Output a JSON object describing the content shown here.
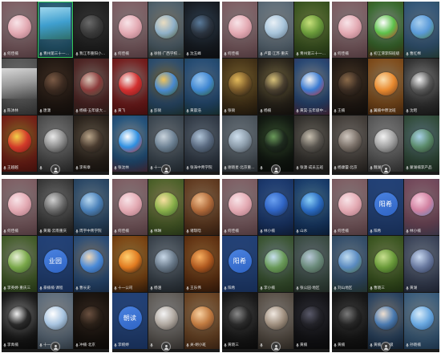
{
  "theme": {
    "speaking_border": "#34c759",
    "label_text": "#e6e6e6",
    "tile_gap": "#141414"
  },
  "icons": {
    "mic": "mic-icon",
    "self_view": "person-icon"
  },
  "screens": [
    {
      "tiles": [
        {
          "name": "何佳楠",
          "colors": [
            "#f8e4e8",
            "#e3aab3",
            "#a4707b"
          ]
        },
        {
          "name": "青州第三十一中学",
          "speaking": true,
          "video": true,
          "colors": [
            "#9fd8ee",
            "#3f9fcf",
            "#2f6f6a"
          ]
        },
        {
          "name": "我江市重阳小学7101班级",
          "colors": [
            "#6a6a6a",
            "#3a3a3a",
            "#1e1e1e"
          ]
        },
        {
          "name": "陈沐林",
          "video": true,
          "colors": [
            "#d8d8d8",
            "#9a9a9a",
            "#4a4a4a"
          ]
        },
        {
          "name": "唐潇",
          "colors": [
            "#7a5a45",
            "#3b2a20",
            "#1a1410"
          ]
        },
        {
          "name": "杨楠-五年级大班级",
          "colors": [
            "#d9c6b8",
            "#8a3b3b",
            "#3f4a3a"
          ]
        },
        {
          "name": "王越越",
          "colors": [
            "#f2d14a",
            "#d23a2a",
            "#7a1a14"
          ]
        },
        {
          "name": "",
          "colors": [
            "#e9e9e9",
            "#8c8c8c",
            "#2a2a2a"
          ]
        },
        {
          "name": "李宥章",
          "colors": [
            "#b9a58a",
            "#4a3c30",
            "#1c1815"
          ]
        }
      ]
    },
    {
      "tiles": [
        {
          "name": "何佳楠",
          "colors": [
            "#f8e4e8",
            "#e3aab3",
            "#a4707b"
          ]
        },
        {
          "name": "徐锐·广西学校班级",
          "colors": [
            "#e9dcc0",
            "#8fb0c8",
            "#4c5a3c"
          ]
        },
        {
          "name": "沈玉峰",
          "colors": [
            "#5a7a9a",
            "#2b3440",
            "#121418"
          ]
        },
        {
          "name": "黄飞",
          "colors": [
            "#f4f0ec",
            "#d23030",
            "#7a1a1a"
          ]
        },
        {
          "name": "彭硕",
          "colors": [
            "#f0c35a",
            "#4a8ad0",
            "#3a5a2a"
          ]
        },
        {
          "name": "黄晨浩",
          "colors": [
            "#9cc8f0",
            "#3f86d1",
            "#2f5a2a"
          ]
        },
        {
          "name": "张沈林",
          "colors": [
            "#ffffff",
            "#2e8fe0",
            "#d0302a"
          ]
        },
        {
          "name": "十一·公司",
          "colors": [
            "#c9d3dc",
            "#6e8294",
            "#2e3a44"
          ]
        },
        {
          "name": "张海中青学院",
          "colors": [
            "#b0c4d8",
            "#5a6a80",
            "#26303a"
          ]
        }
      ]
    },
    {
      "tiles": [
        {
          "name": "何佳楠",
          "colors": [
            "#f8e4e8",
            "#e3aab3",
            "#a4707b"
          ]
        },
        {
          "name": "卢蕾·江苏·重庆",
          "colors": [
            "#e8f0f6",
            "#a8c4da",
            "#5a6f80"
          ]
        },
        {
          "name": "青州第三十一中学",
          "colors": [
            "#c7e07a",
            "#6a9a3a",
            "#2f4a22"
          ]
        },
        {
          "name": "张硕",
          "colors": [
            "#e2b95a",
            "#7a5a2a",
            "#1e1812"
          ]
        },
        {
          "name": "杨楠",
          "colors": [
            "#d8c27a",
            "#4a4030",
            "#141210"
          ]
        },
        {
          "name": "黄昊-五年级中学班",
          "colors": [
            "#f4f4f4",
            "#3a7ad0",
            "#c03030"
          ]
        },
        {
          "name": "谢晓星·北京重庆班",
          "colors": [
            "#cfe0ee",
            "#8a9aa8",
            "#3a4048"
          ]
        },
        {
          "name": "",
          "colors": [
            "#6a9a5a",
            "#1e2a1e",
            "#0c0f0c"
          ]
        },
        {
          "name": "张潇·成员五班",
          "colors": [
            "#c8c0b0",
            "#5a5650",
            "#232220"
          ]
        }
      ]
    },
    {
      "tiles": [
        {
          "name": "何佳楠",
          "colors": [
            "#f8e4e8",
            "#e3aab3",
            "#a4707b"
          ]
        },
        {
          "name": "初江渭李阳班级",
          "colors": [
            "#ffffff",
            "#5cc04a",
            "#c0302a"
          ]
        },
        {
          "name": "曹红棉",
          "colors": [
            "#a9d0f0",
            "#5a9ad8",
            "#4a7a3a"
          ]
        },
        {
          "name": "王楠",
          "colors": [
            "#8a6a4a",
            "#3a2c22",
            "#15110d"
          ]
        },
        {
          "name": "翼楠中原沈班",
          "colors": [
            "#fbe0b0",
            "#e88a30",
            "#6a3a1a"
          ]
        },
        {
          "name": "沈昭",
          "colors": [
            "#f0f0f0",
            "#5a5a5a",
            "#1a1a1a"
          ]
        },
        {
          "name": "杨康蕾·北京",
          "colors": [
            "#d0c8c0",
            "#7a7068",
            "#2a2622"
          ]
        },
        {
          "name": "魏湖泽",
          "colors": [
            "#f2f2f2",
            "#a0a0a0",
            "#404040"
          ]
        },
        {
          "name": "蒙湖楠李产品",
          "colors": [
            "#a8d0e8",
            "#5a8a6a",
            "#2a3a2a"
          ]
        }
      ]
    },
    {
      "tiles": [
        {
          "name": "何佳楠",
          "colors": [
            "#f8e4e8",
            "#e3aab3",
            "#a4707b"
          ]
        },
        {
          "name": "黄瀚·云南重庆",
          "colors": [
            "#d0d0d0",
            "#6a6a6a",
            "#1a1a1a"
          ]
        },
        {
          "name": "周宇中青学院",
          "colors": [
            "#b8d8f0",
            "#4a80b8",
            "#2a3a4a"
          ]
        },
        {
          "name": "李英婷·重庆三",
          "colors": [
            "#e8f0d8",
            "#7aa84a",
            "#3a5a2a"
          ]
        },
        {
          "name": "豪楠楠·课程",
          "avatar_text": "业园",
          "colors": [
            "#4a82e0",
            "#2f64c4"
          ]
        },
        {
          "name": "曹长史",
          "colors": [
            "#f0d8b8",
            "#4a8ad8",
            "#2a4a7a"
          ]
        },
        {
          "name": "李禹楠",
          "colors": [
            "#f0f0f0",
            "#2a2a2a",
            "#080808"
          ]
        },
        {
          "name": "十一·中心",
          "colors": [
            "#ffffff",
            "#a8c4e0",
            "#4a5a6a"
          ]
        },
        {
          "name": "冲楠·北京",
          "colors": [
            "#6a5040",
            "#2a2018",
            "#100c0a"
          ]
        }
      ]
    },
    {
      "tiles": [
        {
          "name": "何佳楠",
          "colors": [
            "#f8e4e8",
            "#e3aab3",
            "#a4707b"
          ]
        },
        {
          "name": "林琳",
          "colors": [
            "#f8e0a0",
            "#8ab04a",
            "#3a5a2a"
          ]
        },
        {
          "name": "诸琰晗",
          "colors": [
            "#f0c090",
            "#b06a3a",
            "#4a2a1a"
          ]
        },
        {
          "name": "十一公司",
          "colors": [
            "#ffd070",
            "#e07a20",
            "#201410"
          ]
        },
        {
          "name": "杨涵",
          "colors": [
            "#c8d8e8",
            "#6a7a8a",
            "#2a323a"
          ]
        },
        {
          "name": "王乐伟",
          "colors": [
            "#f8b060",
            "#b05a20",
            "#3a1c0c"
          ]
        },
        {
          "name": "李婉婷",
          "avatar_text": "朝读",
          "colors": [
            "#4a82e0",
            "#2f64c4"
          ]
        },
        {
          "name": "",
          "colors": [
            "#f4f4f4",
            "#b0a8a0",
            "#4a4440"
          ]
        },
        {
          "name": "关-胡小班",
          "colors": [
            "#f8d0a0",
            "#c07a40",
            "#5a3420"
          ]
        }
      ]
    },
    {
      "tiles": [
        {
          "name": "何佳楠",
          "colors": [
            "#f8e4e8",
            "#e3aab3",
            "#a4707b"
          ]
        },
        {
          "name": "林小楠",
          "colors": [
            "#6aa0f0",
            "#2f64c4",
            "#1a2a4a"
          ]
        },
        {
          "name": "山水",
          "colors": [
            "#8ad0f8",
            "#2a6ac0",
            "#0e2a50"
          ]
        },
        {
          "name": "阳希",
          "avatar_text": "阳希",
          "colors": [
            "#4a82e0",
            "#2f64c4"
          ]
        },
        {
          "name": "李小楠",
          "colors": [
            "#c8e0f0",
            "#6a9a5a",
            "#3a5a2a"
          ]
        },
        {
          "name": "张公园·地区",
          "colors": [
            "#b8c8d8",
            "#6a8a7a",
            "#3a4a40"
          ]
        },
        {
          "name": "黄晓三",
          "colors": [
            "#8a8a8a",
            "#2a2a2a",
            "#0a0a0a"
          ]
        },
        {
          "name": "",
          "colors": [
            "#f0e8e0",
            "#a09080",
            "#40382e"
          ]
        },
        {
          "name": "黄楠",
          "colors": [
            "#5a5a6a",
            "#222228",
            "#0c0c0e"
          ]
        }
      ]
    },
    {
      "tiles": [
        {
          "name": "何佳楠",
          "colors": [
            "#f8e4e8",
            "#e3aab3",
            "#a4707b"
          ]
        },
        {
          "name": "阳希",
          "avatar_text": "阳希",
          "colors": [
            "#4a82e0",
            "#2f64c4"
          ]
        },
        {
          "name": "林小楠",
          "colors": [
            "#f8d0e0",
            "#d080a0",
            "#5a80b0"
          ]
        },
        {
          "name": "刘山地区",
          "colors": [
            "#c0dcf0",
            "#5a8ac0",
            "#4a6a3a"
          ]
        },
        {
          "name": "曹晓三",
          "colors": [
            "#c8e090",
            "#6a9a3a",
            "#2a4a1a"
          ]
        },
        {
          "name": "黄湖",
          "colors": [
            "#c8d8f0",
            "#6a7aa0",
            "#2a3450"
          ]
        },
        {
          "name": "黄楠",
          "colors": [
            "#7a7a7a",
            "#262626",
            "#0a0a0a"
          ]
        },
        {
          "name": "黄楠·一年级",
          "colors": [
            "#f0e0d0",
            "#4a7ab0",
            "#1a2a40"
          ]
        },
        {
          "name": "孙晓楠",
          "colors": [
            "#d8ecfa",
            "#6aa8e0",
            "#2a5a90"
          ]
        }
      ]
    }
  ]
}
